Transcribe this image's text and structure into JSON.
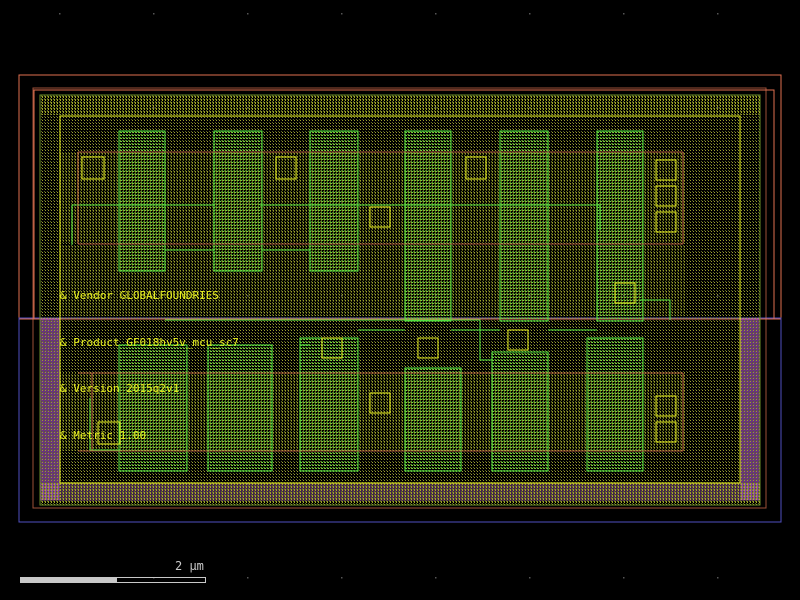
{
  "layout": {
    "annotations": [
      "& Vendor GLOBALFOUNDRIES",
      "& Product GF018hv5v_mcu_sc7",
      "& Version 2015q2v1",
      "& Metric 1.00"
    ]
  },
  "scale_bar": {
    "label": "2 µm"
  },
  "colors": {
    "background": "#000000",
    "grid_dots": "#555555",
    "nwell_outline": "#e07050",
    "pwell_outline": "#5050c0",
    "diffusion": "#9aa030",
    "poly": "#50e040",
    "metal": "#e8f020",
    "implant": "#c060e0",
    "contact": "#e8f020",
    "annotation_text": "#e8f020"
  }
}
